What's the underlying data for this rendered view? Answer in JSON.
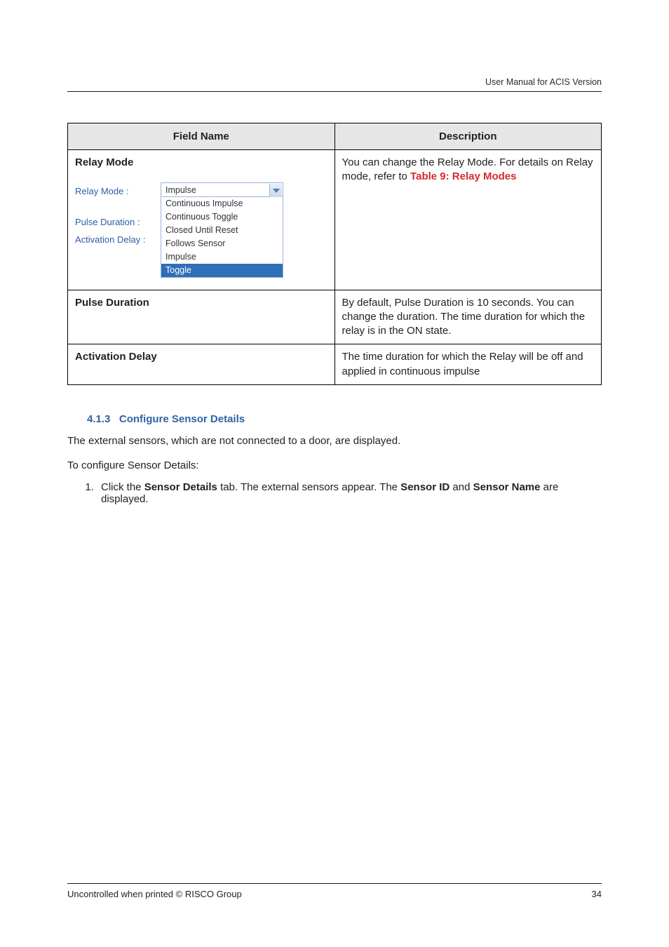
{
  "header": {
    "right": "User Manual for ACIS Version"
  },
  "table": {
    "head": {
      "col1": "Field Name",
      "col2": "Description"
    },
    "rows": [
      {
        "field": "Relay Mode",
        "desc_pre": "You can change the Relay Mode. For details on Relay mode, refer to ",
        "desc_link": "Table 9: Relay Modes",
        "shot": {
          "labels": [
            "Relay Mode :",
            "Pulse Duration :",
            "Activation Delay :"
          ],
          "selected": "Impulse",
          "options": [
            "Continuous Impulse",
            "Continuous Toggle",
            "Closed Until Reset",
            "Follows Sensor",
            "Impulse",
            "Toggle"
          ],
          "highlighted_index": 5
        }
      },
      {
        "field": "Pulse Duration",
        "desc": "By default, Pulse Duration is 10 seconds. You can change the duration. The time duration for which the relay is in the ON state."
      },
      {
        "field": "Activation Delay",
        "desc": "The time duration for which the Relay will be off and applied in continuous impulse"
      }
    ]
  },
  "section": {
    "num": "4.1.3",
    "title": "Configure Sensor Details"
  },
  "para1": "The external sensors, which are not connected to a door, are displayed.",
  "para2": "To configure Sensor Details:",
  "step": {
    "pre": "Click the ",
    "b1": "Sensor Details",
    "mid1": " tab. The external sensors appear. The ",
    "b2": "Sensor ID",
    "mid2": " and ",
    "b3": "Sensor Name",
    "post": " are displayed."
  },
  "footer": {
    "left": "Uncontrolled when printed © RISCO Group",
    "right": "34"
  }
}
